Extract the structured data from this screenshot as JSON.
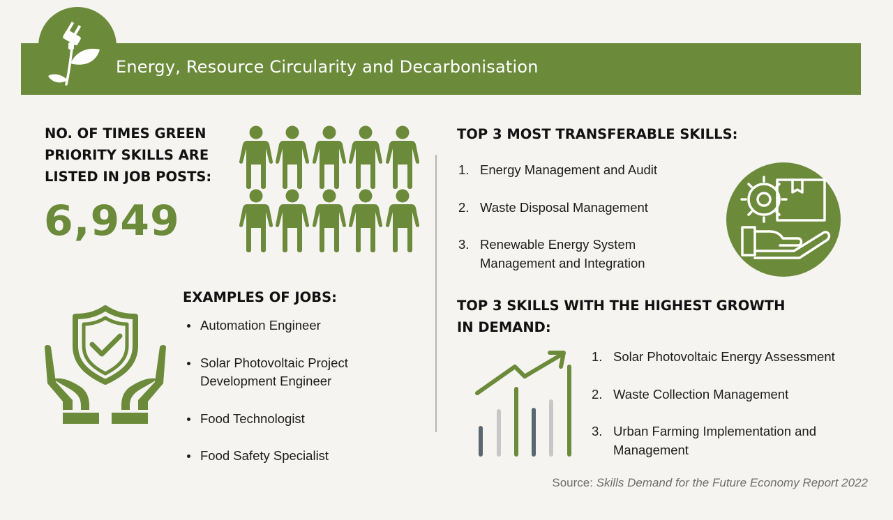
{
  "header": {
    "title": "Energy, Resource Circularity and Decarbonisation",
    "icon": "plug-leaf-icon"
  },
  "colors": {
    "accent": "#6b8a3a",
    "background": "#f6f4f1",
    "text": "#1c1c1c",
    "muted": "#6e6e6e"
  },
  "stat": {
    "heading_lines": [
      "NO. OF TIMES GREEN",
      "PRIORITY SKILLS ARE",
      "LISTED IN JOB POSTS:"
    ],
    "value": "6,949",
    "icon": "people-icon"
  },
  "jobs": {
    "heading": "EXAMPLES OF JOBS:",
    "items": [
      [
        "Automation Engineer"
      ],
      [
        "Solar Photovoltaic Project",
        "Development Engineer"
      ],
      [
        "Food Technologist"
      ],
      [
        "Food Safety Specialist"
      ]
    ],
    "icon": "shield-hands-icon"
  },
  "transferable": {
    "heading": "TOP 3 MOST TRANSFERABLE SKILLS:",
    "items": [
      {
        "num": "1.",
        "lines": [
          "Energy Management and Audit"
        ]
      },
      {
        "num": "2.",
        "lines": [
          "Waste Disposal Management"
        ]
      },
      {
        "num": "3.",
        "lines": [
          "Renewable Energy System",
          "Management and Integration"
        ]
      }
    ],
    "icon": "gear-box-hand-icon"
  },
  "growth": {
    "heading_lines": [
      "TOP 3 SKILLS WITH THE HIGHEST GROWTH",
      "IN DEMAND:"
    ],
    "items": [
      {
        "num": "1.",
        "lines": [
          "Solar Photovoltaic Energy Assessment"
        ]
      },
      {
        "num": "2.",
        "lines": [
          "Waste Collection Management"
        ]
      },
      {
        "num": "3.",
        "lines": [
          "Urban Farming Implementation and",
          "Management"
        ]
      }
    ],
    "icon": "growth-chart-icon"
  },
  "source": {
    "label": "Source:",
    "title": "Skills Demand for the Future Economy Report 2022"
  }
}
